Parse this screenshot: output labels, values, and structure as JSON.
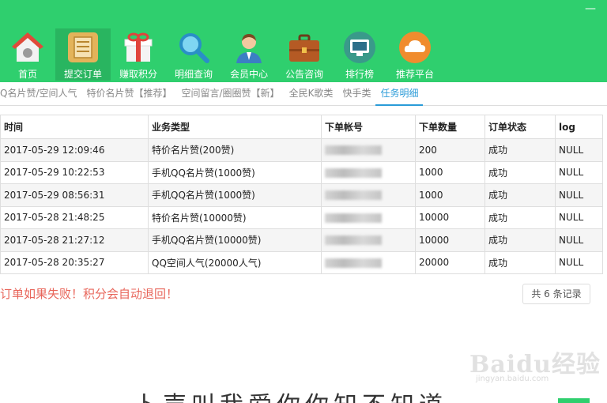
{
  "window": {
    "close_glyph": "—"
  },
  "nav": {
    "items": [
      {
        "label": "首页",
        "icon": "home-icon"
      },
      {
        "label": "提交订单",
        "icon": "order-note-icon"
      },
      {
        "label": "赚取积分",
        "icon": "gift-icon"
      },
      {
        "label": "明细查询",
        "icon": "magnifier-icon"
      },
      {
        "label": "会员中心",
        "icon": "member-icon"
      },
      {
        "label": "公告咨询",
        "icon": "briefcase-icon"
      },
      {
        "label": "排行榜",
        "icon": "monitor-icon"
      },
      {
        "label": "推荐平台",
        "icon": "cloud-icon"
      }
    ],
    "active_index": 1
  },
  "subtabs": {
    "items": [
      "Q名片赞/空间人气",
      "特价名片赞【推荐】",
      "空间留言/圈圈赞【新】",
      "全民K歌类",
      "快手类",
      "任务明细"
    ],
    "active_index": 5
  },
  "table": {
    "headers": [
      "时间",
      "业务类型",
      "下单帐号",
      "下单数量",
      "订单状态",
      "log"
    ],
    "rows": [
      {
        "time": "2017-05-29 12:09:46",
        "type": "特价名片赞(200赞)",
        "qty": "200",
        "status": "成功",
        "log": "NULL"
      },
      {
        "time": "2017-05-29 10:22:53",
        "type": "手机QQ名片赞(1000赞)",
        "qty": "1000",
        "status": "成功",
        "log": "NULL"
      },
      {
        "time": "2017-05-29 08:56:31",
        "type": "手机QQ名片赞(1000赞)",
        "qty": "1000",
        "status": "成功",
        "log": "NULL"
      },
      {
        "time": "2017-05-28 21:48:25",
        "type": "特价名片赞(10000赞)",
        "qty": "10000",
        "status": "成功",
        "log": "NULL"
      },
      {
        "time": "2017-05-28 21:27:12",
        "type": "手机QQ名片赞(10000赞)",
        "qty": "10000",
        "status": "成功",
        "log": "NULL"
      },
      {
        "time": "2017-05-28 20:35:27",
        "type": "QQ空间人气(20000人气)",
        "qty": "20000",
        "status": "成功",
        "log": "NULL"
      }
    ]
  },
  "notice": "订单如果失败！积分会自动退回！",
  "pager": {
    "total_label": "共 6 条记录"
  },
  "watermark": {
    "logo": "Baidu经验",
    "url": "jingyan.baidu.com"
  },
  "caption": "卜声叫我爱你你知不知道",
  "colors": {
    "header_green": "#2fcf6e",
    "tab_active": "#2a9bd8",
    "notice_red": "#e8665b"
  }
}
